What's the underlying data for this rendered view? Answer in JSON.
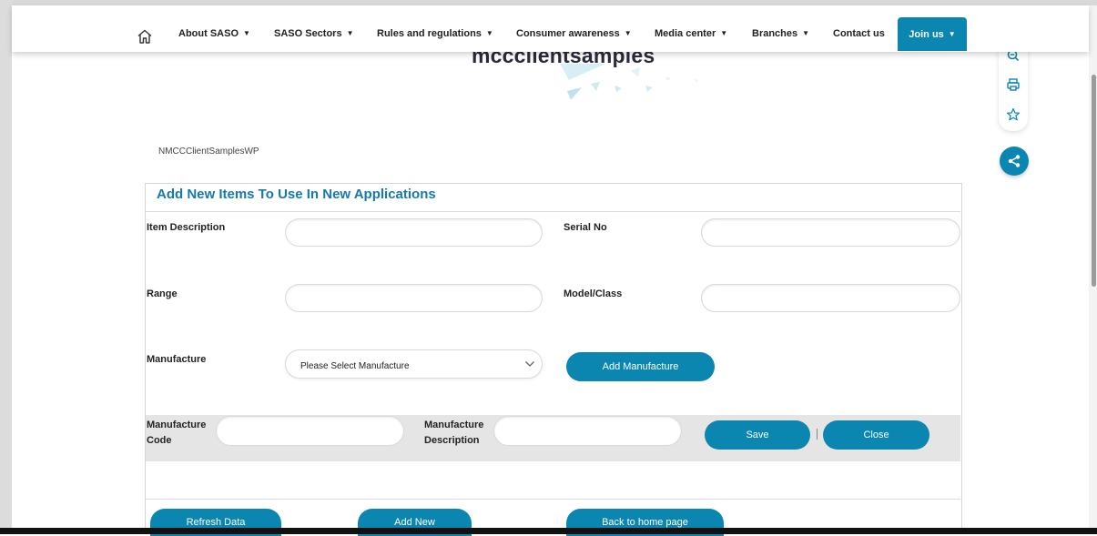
{
  "nav": {
    "items": [
      {
        "label": "About SASO"
      },
      {
        "label": "SASO Sectors"
      },
      {
        "label": "Rules and regulations"
      },
      {
        "label": "Consumer awareness"
      },
      {
        "label": "Media center"
      },
      {
        "label": "Branches"
      },
      {
        "label": "Contact us"
      }
    ],
    "join_label": "Join us"
  },
  "brand": {
    "title": "mccclientsamples"
  },
  "breadcrumb": {
    "text": "NMCCClientSamplesWP"
  },
  "panel": {
    "title": "Add New Items To Use In New Applications",
    "item_description_label": "Item Description",
    "serial_no_label": "Serial No",
    "range_label": "Range",
    "model_class_label": "Model/Class",
    "manufacture_label": "Manufacture",
    "manufacture_select_value": "Please Select Manufacture",
    "add_manufacture_label": "Add Manufacture",
    "manufacture_code_label_1": "Manufacture",
    "manufacture_code_label_2": "Code",
    "manufacture_desc_label_1": "Manufacture",
    "manufacture_desc_label_2": "Description",
    "save_label": "Save",
    "close_label": "Close"
  },
  "footer_buttons": {
    "refresh_label": "Refresh Data",
    "add_new_label": "Add New",
    "back_label": "Back to home page"
  },
  "colors": {
    "accent": "#0b86b0",
    "title": "#1679a8"
  }
}
